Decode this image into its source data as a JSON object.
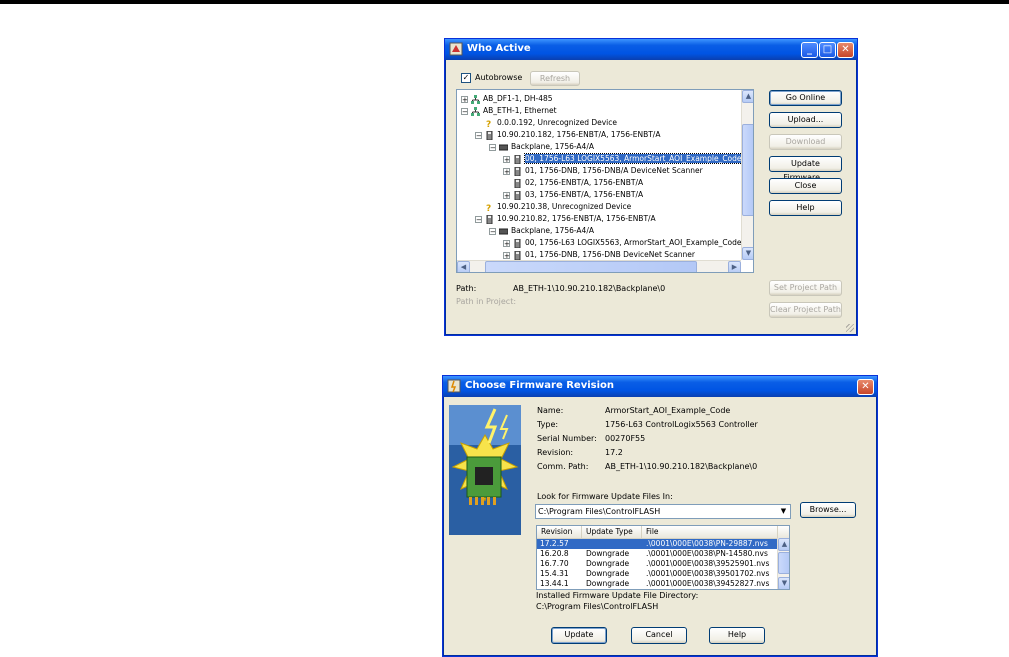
{
  "who_active": {
    "title": "Who Active",
    "autobrowse_label": "Autobrowse",
    "autobrowse_checked": true,
    "refresh_label": "Refresh",
    "tree": [
      {
        "depth": 0,
        "exp": "+",
        "icon": "network",
        "text": "AB_DF1-1, DH-485"
      },
      {
        "depth": 0,
        "exp": "-",
        "icon": "network",
        "text": "AB_ETH-1, Ethernet"
      },
      {
        "depth": 1,
        "exp": "",
        "icon": "unknown",
        "text": "0.0.0.192, Unrecognized Device"
      },
      {
        "depth": 1,
        "exp": "-",
        "icon": "module",
        "text": "10.90.210.182, 1756-ENBT/A, 1756-ENBT/A"
      },
      {
        "depth": 2,
        "exp": "-",
        "icon": "backplane",
        "text": "Backplane, 1756-A4/A"
      },
      {
        "depth": 3,
        "exp": "+",
        "icon": "module",
        "text": "00, 1756-L63 LOGIX5563, ArmorStart_AOI_Example_Code",
        "selected": true
      },
      {
        "depth": 3,
        "exp": "+",
        "icon": "module",
        "text": "01, 1756-DNB, 1756-DNB/A DeviceNet Scanner"
      },
      {
        "depth": 3,
        "exp": "",
        "icon": "module",
        "text": "02, 1756-ENBT/A, 1756-ENBT/A"
      },
      {
        "depth": 3,
        "exp": "+",
        "icon": "module",
        "text": "03, 1756-ENBT/A, 1756-ENBT/A"
      },
      {
        "depth": 1,
        "exp": "",
        "icon": "unknown",
        "text": "10.90.210.38, Unrecognized Device"
      },
      {
        "depth": 1,
        "exp": "-",
        "icon": "module",
        "text": "10.90.210.82, 1756-ENBT/A, 1756-ENBT/A"
      },
      {
        "depth": 2,
        "exp": "-",
        "icon": "backplane",
        "text": "Backplane, 1756-A4/A"
      },
      {
        "depth": 3,
        "exp": "+",
        "icon": "module",
        "text": "00, 1756-L63 LOGIX5563, ArmorStart_AOI_Example_Code"
      },
      {
        "depth": 3,
        "exp": "+",
        "icon": "module",
        "text": "01, 1756-DNB, 1756-DNB DeviceNet Scanner"
      }
    ],
    "path_label": "Path:",
    "path_value": "AB_ETH-1\\10.90.210.182\\Backplane\\0",
    "path_in_project_label": "Path in Project:",
    "buttons": {
      "go_online": "Go Online",
      "upload": "Upload...",
      "download": "Download",
      "update_firmware": "Update Firmware...",
      "close": "Close",
      "help": "Help",
      "set_project_path": "Set Project Path",
      "clear_project_path": "Clear Project Path"
    }
  },
  "firmware": {
    "title": "Choose Firmware Revision",
    "info": [
      {
        "label": "Name:",
        "value": "ArmorStart_AOI_Example_Code"
      },
      {
        "label": "Type:",
        "value": "1756-L63 ControlLogix5563 Controller"
      },
      {
        "label": "Serial Number:",
        "value": "00270F55"
      },
      {
        "label": "Revision:",
        "value": "17.2"
      },
      {
        "label": "Comm. Path:",
        "value": "AB_ETH-1\\10.90.210.182\\Backplane\\0"
      }
    ],
    "look_for_label": "Look for Firmware Update Files In:",
    "look_for_value": "C:\\Program Files\\ControlFLASH",
    "browse_label": "Browse...",
    "columns": [
      "Revision",
      "Update Type",
      "File"
    ],
    "rows": [
      {
        "revision": "17.2.57",
        "type": "",
        "file": ".\\0001\\000E\\0038\\PN-29887.nvs",
        "selected": true
      },
      {
        "revision": "16.20.8",
        "type": "Downgrade",
        "file": ".\\0001\\000E\\0038\\PN-14580.nvs"
      },
      {
        "revision": "16.7.70",
        "type": "Downgrade",
        "file": ".\\0001\\000E\\0038\\39525901.nvs"
      },
      {
        "revision": "15.4.31",
        "type": "Downgrade",
        "file": ".\\0001\\000E\\0038\\39501702.nvs"
      },
      {
        "revision": "13.44.1",
        "type": "Downgrade",
        "file": ".\\0001\\000E\\0038\\39452827.nvs"
      }
    ],
    "installed_label": "Installed Firmware Update File Directory:",
    "installed_value": "C:\\Program Files\\ControlFLASH",
    "buttons": {
      "update": "Update",
      "cancel": "Cancel",
      "help": "Help"
    }
  }
}
